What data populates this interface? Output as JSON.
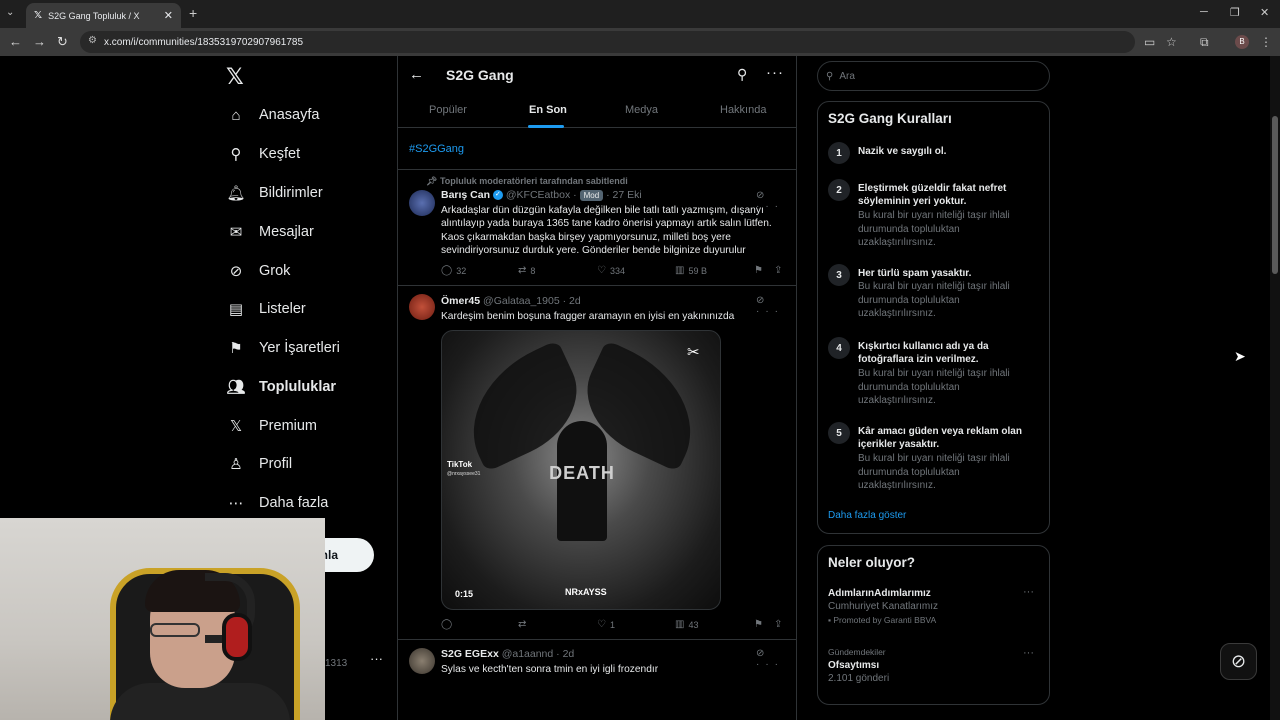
{
  "browser": {
    "tab_title": "S2G Gang Topluluk / X",
    "url": "x.com/i/communities/1835319702907961785"
  },
  "nav": {
    "items": [
      {
        "label": "Anasayfa",
        "icon": "home-icon"
      },
      {
        "label": "Keşfet",
        "icon": "search-icon"
      },
      {
        "label": "Bildirimler",
        "icon": "bell-icon"
      },
      {
        "label": "Mesajlar",
        "icon": "mail-icon"
      },
      {
        "label": "Grok",
        "icon": "grok-icon"
      },
      {
        "label": "Listeler",
        "icon": "list-icon"
      },
      {
        "label": "Yer İşaretleri",
        "icon": "bookmark-icon"
      },
      {
        "label": "Topluluklar",
        "icon": "communities-icon"
      },
      {
        "label": "Premium",
        "icon": "x-icon"
      },
      {
        "label": "Profil",
        "icon": "profile-icon"
      },
      {
        "label": "Daha fazla",
        "icon": "more-circle-icon"
      }
    ],
    "post_button_partial": "nla",
    "account_handle_partial": "1313"
  },
  "community": {
    "name": "S2G Gang",
    "tabs": [
      "Popüler",
      "En Son",
      "Medya",
      "Hakkında"
    ],
    "active_tab": "En Son",
    "hashtag": "#S2GGang"
  },
  "tweets": [
    {
      "pinned_label": "Topluluk moderatörleri tarafından sabitlendi",
      "name": "Barış Can",
      "handle": "@KFCEatbox",
      "badge": "Mod",
      "time": "· 27 Eki",
      "text": "Arkadaşlar dün düzgün kafayla değilken bile tatlı tatlı yazmışım, dışanyı alıntılayıp yada buraya 1365 tane kadro önerisi yapmayı artık salın lütfen. Kaos çıkarmakdan başka birşey yapmıyorsunuz, milleti boş yere sevindiriyorsunuz durduk yere. Gönderiler bende bilginize duyurulur",
      "replies": "32",
      "retweets": "8",
      "likes": "334",
      "views": "59 B"
    },
    {
      "name": "Ömer45",
      "handle": "@Galataa_1905",
      "time": "· 2d",
      "text": "Kardeşim benim boşuna fragger aramayın en iyisi en yakınınızda",
      "media": {
        "overlay_text": "DEATH",
        "tiktok_label": "TikTok",
        "tiktok_user": "@nrxayssee31",
        "duration": "0:15",
        "watermark": "NRxAYSS"
      },
      "replies": "",
      "retweets": "",
      "likes": "1",
      "views": "43"
    },
    {
      "name": "S2G EGExx",
      "handle": "@a1aannd",
      "time": "· 2d",
      "text": "Sylas ve kecth'ten sonra tmin en iyi igli frozendır"
    }
  ],
  "sidebar": {
    "search_placeholder": "Ara",
    "rules_title": "S2G Gang Kuralları",
    "rules": [
      {
        "num": "1",
        "title": "Nazik ve saygılı ol.",
        "desc": ""
      },
      {
        "num": "2",
        "title": "Eleştirmek güzeldir fakat nefret söyleminin yeri yoktur.",
        "desc": "Bu kural bir uyarı niteliği taşır ihlali durumunda topluluktan uzaklaştırılırsınız."
      },
      {
        "num": "3",
        "title": "Her türlü spam yasaktır.",
        "desc": "Bu kural bir uyarı niteliği taşır ihlali durumunda topluluktan uzaklaştırılırsınız."
      },
      {
        "num": "4",
        "title": "Kışkırtıcı kullanıcı adı ya da fotoğraflara izin verilmez.",
        "desc": "Bu kural bir uyarı niteliği taşır ihlali durumunda topluluktan uzaklaştırılırsınız."
      },
      {
        "num": "5",
        "title": "Kâr amacı güden veya reklam olan içerikler yasaktır.",
        "desc": "Bu kural bir uyarı niteliği taşır ihlali durumunda topluluktan uzaklaştırılırsınız."
      }
    ],
    "show_more": "Daha fazla göster",
    "trends_title": "Neler oluyor?",
    "trends": [
      {
        "title": "AdımlarınAdımlarımız",
        "sub": "Cumhuriyet Kanatlarımız",
        "promo": "Promoted by Garanti BBVA"
      },
      {
        "label": "Gündemdekiler",
        "title": "Ofsaytımsı",
        "sub": "2.101 gönderi"
      }
    ]
  },
  "colors": {
    "accent": "#1d9bf0",
    "background": "#000000",
    "border": "#2f3336",
    "muted_text": "#71767b"
  }
}
